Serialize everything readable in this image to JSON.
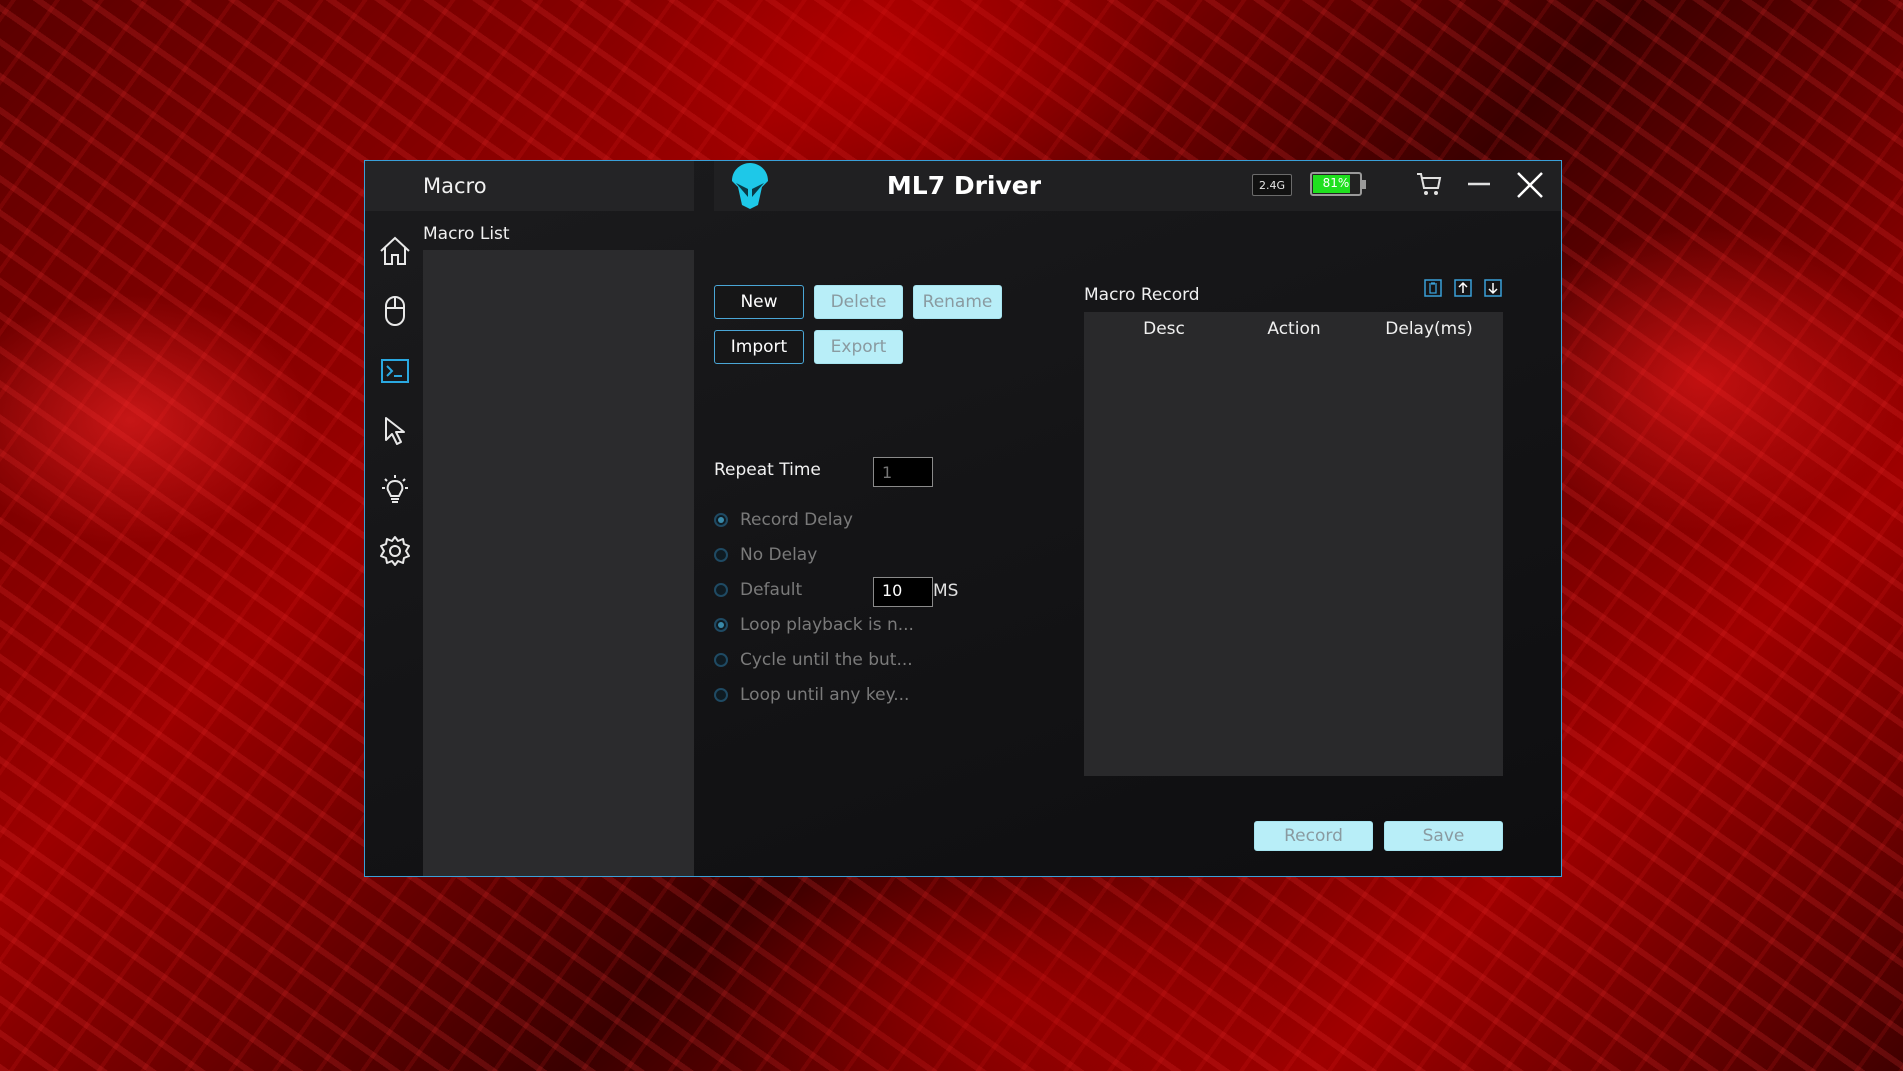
{
  "left_header": {
    "title": "Macro"
  },
  "app": {
    "title": "ML7 Driver"
  },
  "status": {
    "connection": "2.4G",
    "battery_label": "81%",
    "battery_level": 0.81
  },
  "nav": [
    "home-icon",
    "mouse-icon",
    "terminal-icon",
    "cursor-icon",
    "lightbulb-icon",
    "gear-icon"
  ],
  "macro_list": {
    "label": "Macro List"
  },
  "buttons": {
    "new": "New",
    "delete": "Delete",
    "rename": "Rename",
    "import": "Import",
    "export": "Export",
    "record": "Record",
    "save": "Save"
  },
  "repeat": {
    "label": "Repeat Time",
    "placeholder": "1"
  },
  "delay_options": {
    "record_delay": "Record Delay",
    "no_delay": "No Delay",
    "default": "Default",
    "default_value": "10",
    "unit": "MS"
  },
  "loop_options": {
    "loop_playback": "Loop playback is n...",
    "cycle_until": "Cycle until the but...",
    "loop_until_key": "Loop until any key..."
  },
  "macro_record": {
    "title": "Macro Record",
    "columns": [
      "Desc",
      "Action",
      "Delay(ms)"
    ]
  },
  "colors": {
    "accent": "#3aa0d8",
    "logo": "#1ec8e8",
    "button_fill": "#b8eef8",
    "battery": "#1fe01f"
  }
}
